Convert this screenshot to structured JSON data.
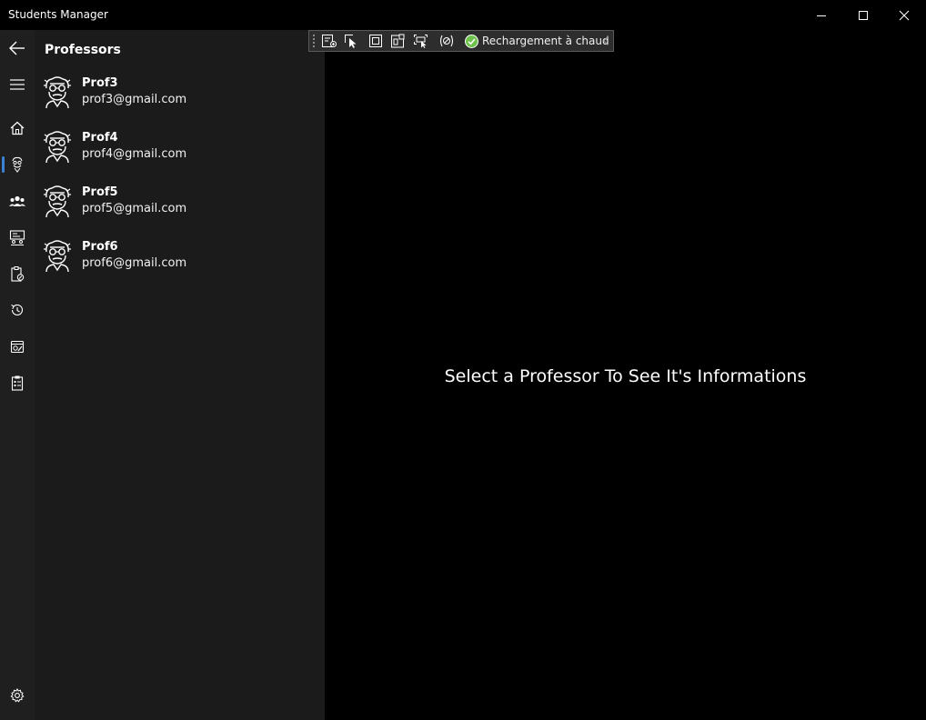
{
  "window": {
    "title": "Students Manager",
    "minimize_icon": "minimize-icon",
    "maximize_icon": "maximize-icon",
    "close_icon": "close-icon"
  },
  "debug_toolbar": {
    "tools": [
      "live-visual-tree-icon",
      "select-element-icon",
      "display-adorners-icon",
      "track-focus-icon",
      "layout-adorners-icon",
      "binding-failures-icon"
    ],
    "hot_reload_status_icon": "check-circle-icon",
    "hot_reload_label": "Rechargement à chaud",
    "hot_reload_status_color": "#6cc24a",
    "collapse_icon": "chevron-left-icon"
  },
  "nav": {
    "back_icon": "back-arrow-icon",
    "menu_icon": "hamburger-icon",
    "items": [
      {
        "icon": "home-icon",
        "selected": false
      },
      {
        "icon": "professor-icon",
        "selected": true
      },
      {
        "icon": "students-group-icon",
        "selected": false
      },
      {
        "icon": "classroom-board-icon",
        "selected": false
      },
      {
        "icon": "clipboard-edit-icon",
        "selected": false
      },
      {
        "icon": "history-icon",
        "selected": false
      },
      {
        "icon": "calendar-pen-icon",
        "selected": false
      },
      {
        "icon": "clipboard-list-icon",
        "selected": false
      }
    ],
    "settings_icon": "gear-icon",
    "accent_color": "#3b82d6"
  },
  "professors": {
    "title": "Professors",
    "avatar_icon": "professor-avatar-icon",
    "items": [
      {
        "name": "Prof3",
        "email": "prof3@gmail.com"
      },
      {
        "name": "Prof4",
        "email": "prof4@gmail.com"
      },
      {
        "name": "Prof5",
        "email": "prof5@gmail.com"
      },
      {
        "name": "Prof6",
        "email": "prof6@gmail.com"
      }
    ]
  },
  "detail": {
    "placeholder": "Select a Professor To See It's Informations"
  },
  "colors": {
    "background": "#000000",
    "nav_background": "#1f1f1f",
    "list_background": "#1b1b1b",
    "toolbar_background": "#2d2d2d"
  }
}
